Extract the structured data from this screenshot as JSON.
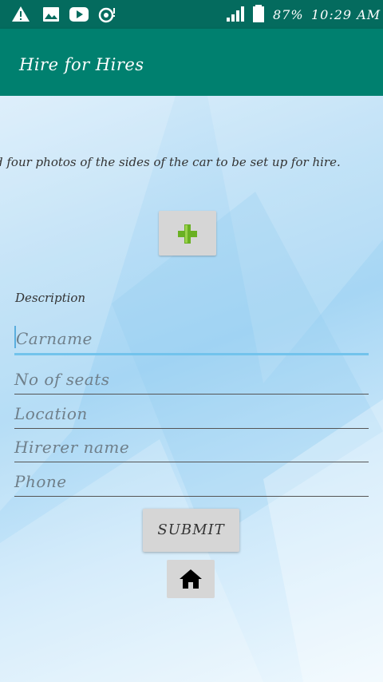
{
  "status_bar": {
    "icons_left": [
      "warning-icon",
      "image-icon",
      "youtube-icon",
      "sync-icon"
    ],
    "battery_percent": "87%",
    "time": "10:29 AM",
    "signal_bars": 4
  },
  "app_bar": {
    "title": "Hire for Hires"
  },
  "content": {
    "instruction": "d four photos of the sides of the car to be set up for hire.",
    "add_photo_icon": "plus-icon",
    "description_label": "Description",
    "fields": [
      {
        "placeholder": "Carname",
        "value": "",
        "focused": true
      },
      {
        "placeholder": "No of seats",
        "value": ""
      },
      {
        "placeholder": "Location",
        "value": ""
      },
      {
        "placeholder": "Hirerer name",
        "value": ""
      },
      {
        "placeholder": "Phone",
        "value": ""
      }
    ],
    "submit_label": "SUBMIT",
    "home_icon": "home-icon"
  },
  "colors": {
    "status_bar": "#046b5e",
    "app_bar": "#00806f",
    "focus_underline": "#72c3ec",
    "plus_green": "#6ab023"
  }
}
